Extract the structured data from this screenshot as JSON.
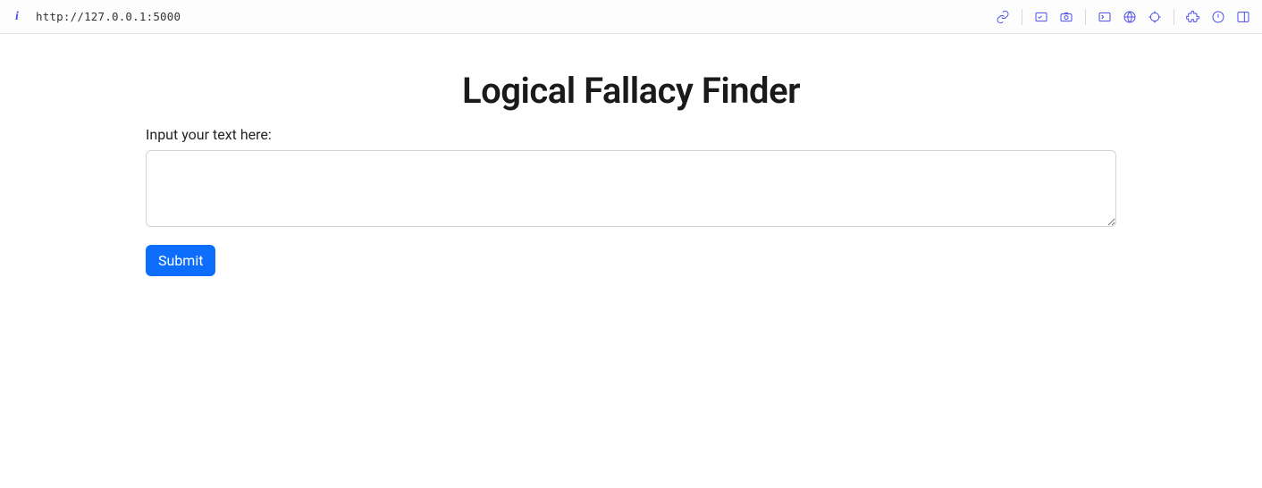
{
  "browser": {
    "url": "http://127.0.0.1:5000"
  },
  "page": {
    "title": "Logical Fallacy Finder",
    "input_label": "Input your text here:",
    "textarea_value": "",
    "submit_label": "Submit"
  }
}
